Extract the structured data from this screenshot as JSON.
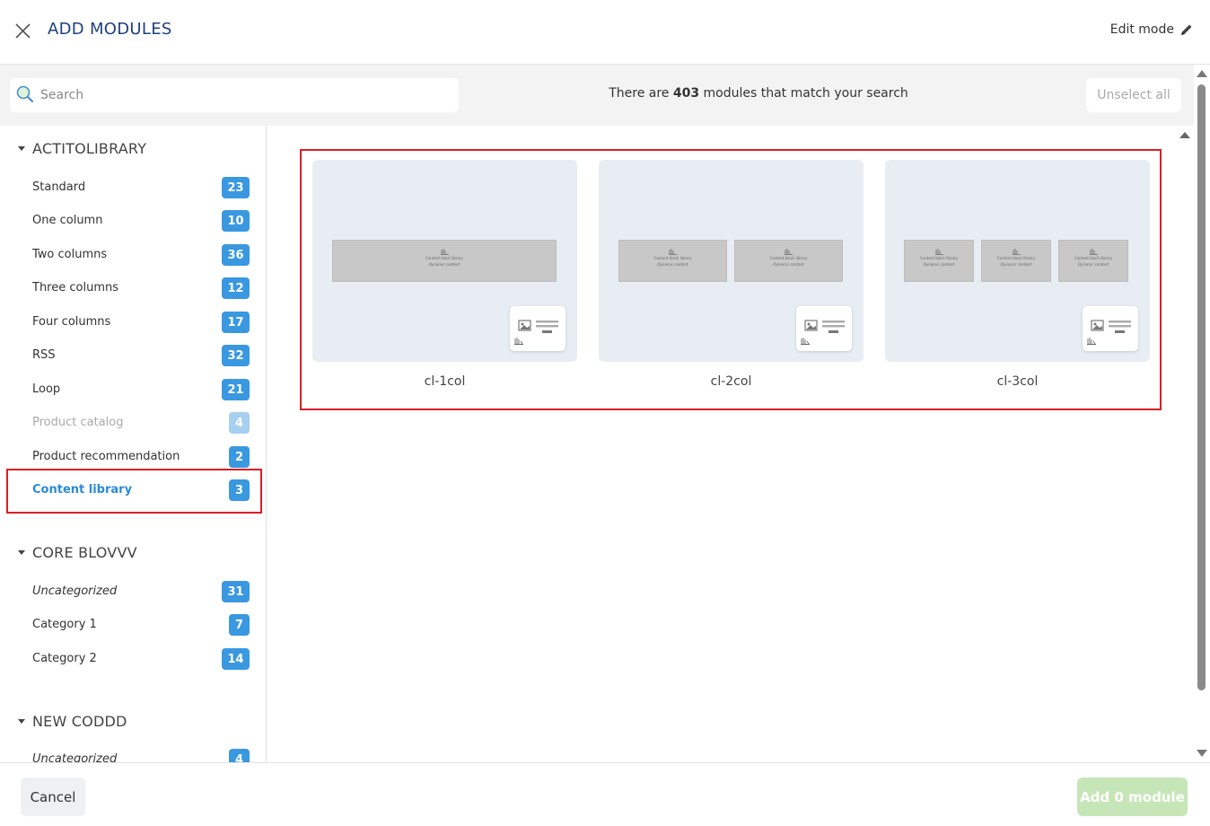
{
  "header": {
    "title": "ADD MODULES",
    "edit_mode_label": "Edit mode"
  },
  "search": {
    "placeholder": "Search",
    "match_prefix": "There are ",
    "match_count": "403",
    "match_suffix": " modules that match your search",
    "unselect_label": "Unselect all"
  },
  "sidebar": {
    "groups": [
      {
        "title": "ACTITOLIBRARY",
        "items": [
          {
            "label": "Standard",
            "count": "23"
          },
          {
            "label": "One column",
            "count": "10"
          },
          {
            "label": "Two columns",
            "count": "36"
          },
          {
            "label": "Three columns",
            "count": "12"
          },
          {
            "label": "Four columns",
            "count": "17"
          },
          {
            "label": "RSS",
            "count": "32"
          },
          {
            "label": "Loop",
            "count": "21"
          },
          {
            "label": "Product catalog",
            "count": "4",
            "state": "disabled"
          },
          {
            "label": "Product recommendation",
            "count": "2"
          },
          {
            "label": "Content library",
            "count": "3",
            "state": "selected"
          }
        ]
      },
      {
        "title": "CORE BLOVVV",
        "items": [
          {
            "label": "Uncategorized",
            "count": "31",
            "style": "italic"
          },
          {
            "label": "Category 1",
            "count": "7"
          },
          {
            "label": "Category 2",
            "count": "14"
          }
        ]
      },
      {
        "title": "NEW CODDD",
        "items": [
          {
            "label": "Uncategorized",
            "count": "4",
            "style": "italic"
          }
        ]
      }
    ]
  },
  "modules": [
    {
      "name": "cl-1col",
      "columns": 1
    },
    {
      "name": "cl-2col",
      "columns": 2
    },
    {
      "name": "cl-3col",
      "columns": 3
    }
  ],
  "thumbnail": {
    "line1": "Content block library",
    "line2": "Dynamic content"
  },
  "footer": {
    "cancel_label": "Cancel",
    "add_label": "Add 0 module"
  },
  "colors": {
    "title": "#1f3f7f",
    "badge": "#3a98e0",
    "badge_disabled": "#a7cff0",
    "active_label": "#2a8ad8",
    "highlight_border": "#dc1e24",
    "add_button": "#c6e6b8"
  }
}
